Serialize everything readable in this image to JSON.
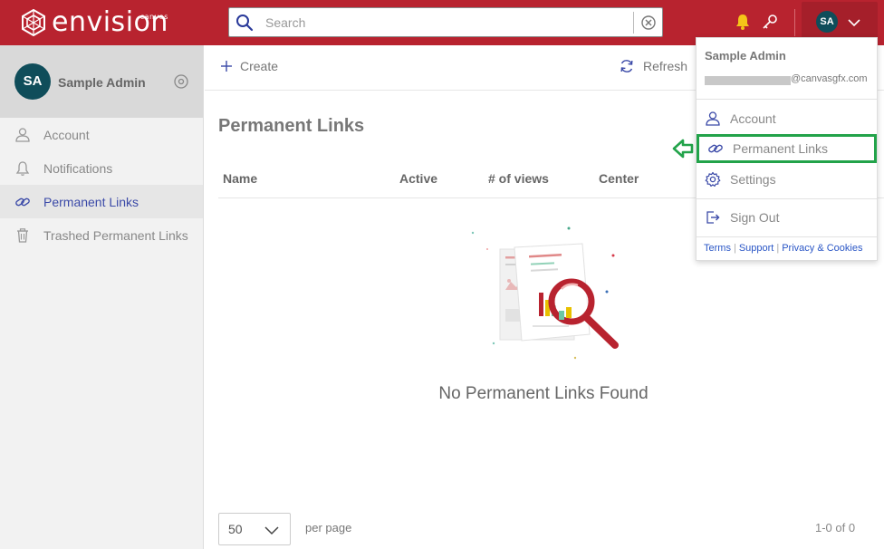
{
  "header": {
    "logo_text": "envision",
    "logo_sup": "canvas",
    "search_placeholder": "Search",
    "user_initials": "SA",
    "brand_color": "#b8232f",
    "notification_color": "#f5c518",
    "icons": [
      "search-icon",
      "clear-icon",
      "bell-icon",
      "key-icon",
      "chevron-down-icon"
    ]
  },
  "sidebar": {
    "profile": {
      "initials": "SA",
      "name": "Sample Admin"
    },
    "items": [
      {
        "label": "Account",
        "icon": "user-icon",
        "active": false
      },
      {
        "label": "Notifications",
        "icon": "bell-icon",
        "active": false
      },
      {
        "label": "Permanent Links",
        "icon": "link-icon",
        "active": true
      },
      {
        "label": "Trashed Permanent Links",
        "icon": "trash-icon",
        "active": false
      }
    ]
  },
  "toolbar": {
    "create_label": "Create",
    "refresh_label": "Refresh"
  },
  "main": {
    "title": "Permanent Links",
    "columns": [
      "Name",
      "Active",
      "# of views",
      "Center"
    ],
    "empty_message": "No Permanent Links Found"
  },
  "pagination": {
    "page_size": "50",
    "per_page_label": "per page",
    "range": "1-0 of 0"
  },
  "user_dropdown": {
    "name": "Sample Admin",
    "email_suffix": "@canvasgfx.com",
    "items": [
      {
        "label": "Account",
        "icon": "user-icon"
      },
      {
        "label": "Permanent Links",
        "icon": "link-icon",
        "highlighted": true
      },
      {
        "label": "Settings",
        "icon": "gear-icon"
      },
      {
        "label": "Sign Out",
        "icon": "sign-out-icon"
      }
    ],
    "footer_links": [
      "Terms",
      "Support",
      "Privacy & Cookies"
    ],
    "highlight_color": "#22a34a"
  }
}
